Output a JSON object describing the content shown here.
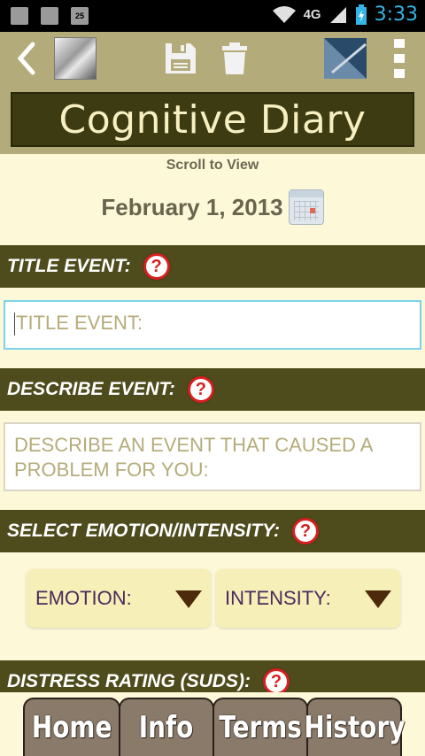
{
  "status_bar": {
    "network": "4G",
    "time": "3:33",
    "notif_badge": "25"
  },
  "action_bar": {
    "icons": [
      "back-icon",
      "app-logo-icon",
      "save-icon",
      "trash-icon",
      "tile-icon",
      "overflow-menu-icon"
    ]
  },
  "header": {
    "title": "Cognitive Diary"
  },
  "scroll_hint": "Scroll to View",
  "date": "February 1, 2013",
  "sections": {
    "title_event": "TITLE EVENT:",
    "describe_event": "DESCRIBE EVENT:",
    "select_emotion": "SELECT EMOTION/INTENSITY:",
    "distress_rating": "DISTRESS RATING (SUDS):"
  },
  "help_icon": "?",
  "inputs": {
    "title_placeholder": "TITLE EVENT:",
    "describe_placeholder": "DESCRIBE AN EVENT THAT CAUSED A PROBLEM FOR YOU:"
  },
  "dropdowns": {
    "emotion": "EMOTION:",
    "intensity": "INTENSITY:"
  },
  "nav": {
    "home": "Home",
    "info": "Info",
    "terms": "Terms",
    "history": "History"
  }
}
